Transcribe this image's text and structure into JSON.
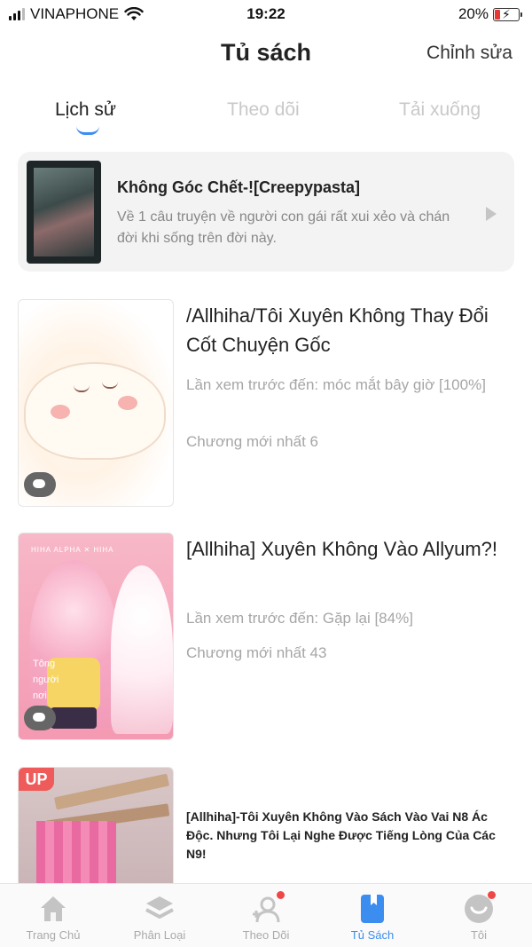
{
  "status_bar": {
    "carrier": "VINAPHONE",
    "time": "19:22",
    "battery": "20%",
    "battery_level": 0.2
  },
  "header": {
    "title": "Tủ sách",
    "edit_label": "Chỉnh sửa"
  },
  "tabs": [
    {
      "label": "Lịch sử",
      "active": true
    },
    {
      "label": "Theo dõi",
      "active": false
    },
    {
      "label": "Tải xuống",
      "active": false
    }
  ],
  "recent": {
    "title": "Không Góc Chết-![Creepypasta]",
    "description": "Về 1 câu truyện về người con gái rất xui xẻo và chán đời khi sống trên đời này."
  },
  "books": [
    {
      "title": "/Allhiha/Tôi Xuyên Không Thay Đổi Cốt Chuyện Gốc",
      "last_read": "Lần xem trước đến:  móc mắt bây giờ [100%]",
      "latest_chapter": "Chương mới nhất 6"
    },
    {
      "title": "[Allhiha] Xuyên Không Vào Allyum?!",
      "last_read": "Lần xem trước đến:  Gặp lại [84%]",
      "latest_chapter": "Chương mới nhất 43"
    },
    {
      "title": "[Allhiha]-Tôi Xuyên Không Vào Sách Vào Vai N8 Ác Độc. Nhưng Tôi Lại Nghe Được Tiếng Lòng Của Các N9!",
      "badge": "UP"
    }
  ],
  "bottom_nav": [
    {
      "label": "Trang Chủ",
      "icon": "home-icon",
      "active": false
    },
    {
      "label": "Phân Loại",
      "icon": "layers-icon",
      "active": false
    },
    {
      "label": "Theo Dõi",
      "icon": "follow-icon",
      "active": false
    },
    {
      "label": "Tủ Sách",
      "icon": "bookshelf-icon",
      "active": true
    },
    {
      "label": "Tôi",
      "icon": "profile-icon",
      "active": false
    }
  ],
  "colors": {
    "accent": "#3b8ef0",
    "notification": "#ef4646",
    "muted": "#a6a6a6"
  }
}
